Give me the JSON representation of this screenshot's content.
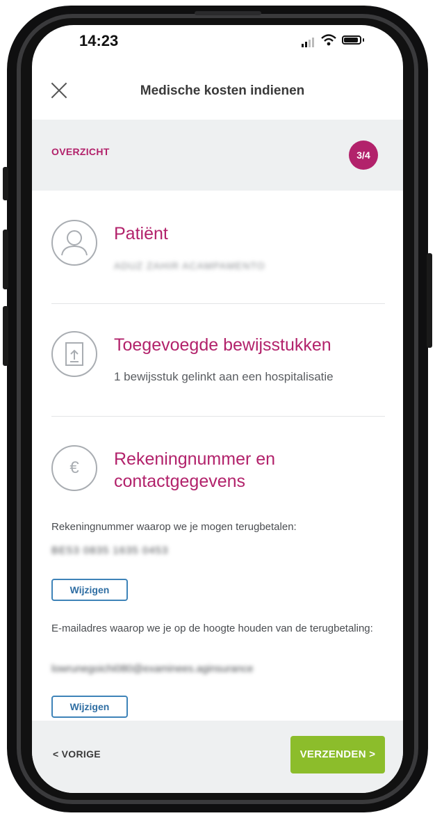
{
  "status_bar": {
    "time": "14:23"
  },
  "header": {
    "title": "Medische kosten indienen"
  },
  "step": {
    "label": "OVERZICHT",
    "badge": "3/4"
  },
  "patient": {
    "title": "Patiënt",
    "name": "ADUZ ZAHIR ACAMPAMENTO"
  },
  "attachments": {
    "title": "Toegevoegde bewijsstukken",
    "summary": "1 bewijsstuk gelinkt aan een hospitalisatie"
  },
  "account": {
    "title_line1": "Rekeningnummer en",
    "title_line2": "contactgegevens",
    "iban_label": "Rekeningnummer waarop we je mogen terugbetalen:",
    "iban_value": "BE53 0835 1635 0453",
    "edit_label": "Wijzigen",
    "email_label": "E-mailadres waarop we je op de hoogte houden van de terugbetaling:",
    "email_value": "lowrunegoichi080@examinees.aginsurance",
    "edit_label_2": "Wijzigen"
  },
  "footer": {
    "prev_label": "< VORIGE",
    "send_label": "VERZENDEN >"
  },
  "colors": {
    "accent": "#b2226b",
    "send": "#8cbd2b",
    "link": "#3e83b8",
    "panel": "#eef0f1"
  },
  "icons": [
    "close-icon",
    "person-icon",
    "document-upload-icon",
    "euro-icon",
    "signal-icon",
    "wifi-icon",
    "battery-icon"
  ]
}
